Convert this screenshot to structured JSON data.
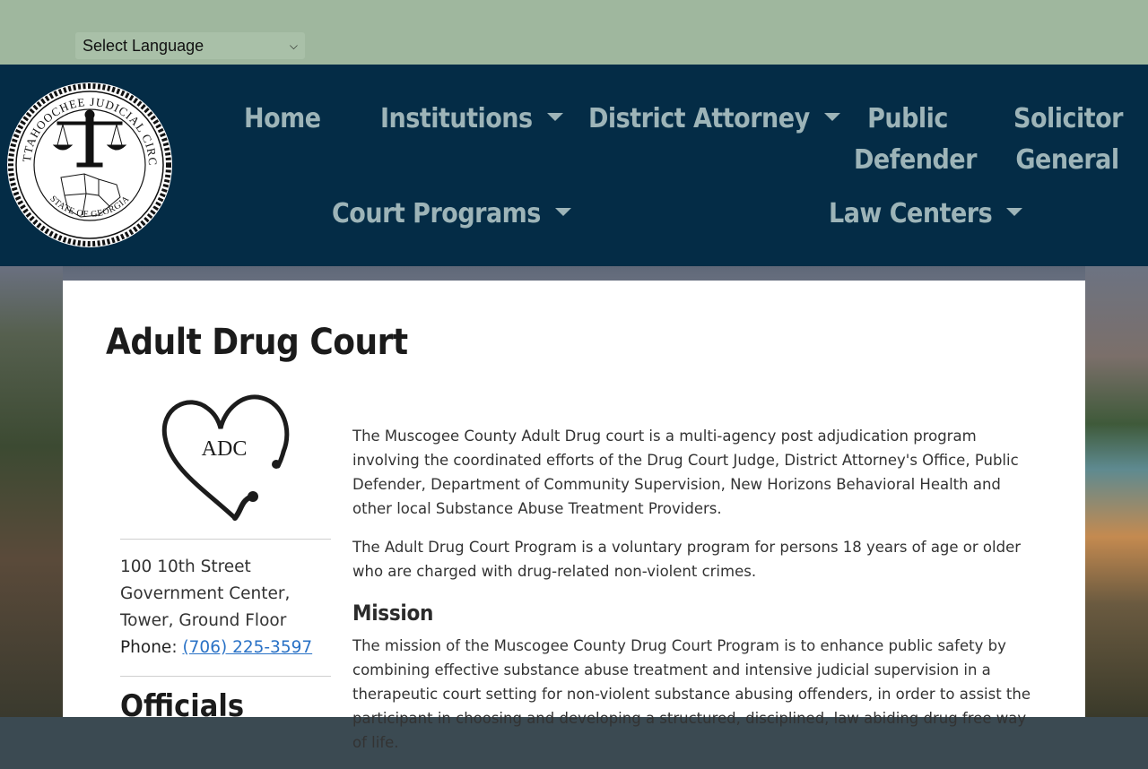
{
  "language": {
    "selected": "Select Language"
  },
  "seal": {
    "top_text": "CHATTAHOOCHEE JUDICIAL CIRCUIT",
    "bottom_text": "STATE OF GEORGIA"
  },
  "nav": {
    "home": "Home",
    "institutions": "Institutions",
    "district_attorney": "District Attorney",
    "public_defender_1": "Public",
    "public_defender_2": "Defender",
    "solicitor_general_1": "Solicitor",
    "solicitor_general_2": "General",
    "court_programs": "Court Programs",
    "law_centers": "Law Centers"
  },
  "page": {
    "title": "Adult Drug Court",
    "logo_text": "ADC"
  },
  "address": {
    "line1": "100 10th Street",
    "line2": "Government Center,",
    "line3": "Tower, Ground Floor",
    "phone_label": "Phone",
    "phone_number": "(706) 225-3597"
  },
  "officials_heading": "Officials",
  "content": {
    "p1": "The Muscogee County Adult Drug court is a multi-agency post adjudication program involving the coordinated efforts of the Drug Court Judge, District Attorney's Office, Public Defender, Department of Community Supervision, New Horizons Behavioral Health and other local Substance Abuse Treatment Providers.",
    "p2": "The Adult Drug Court Program is a voluntary program for persons 18 years of age or older who are charged with drug-related non-violent crimes.",
    "mission_heading": "Mission",
    "p3": "The mission of the Muscogee County Drug Court Program is to enhance public safety by combining effective substance abuse treatment and intensive judicial supervision in a therapeutic court setting for non-violent substance abusing offenders, in order to assist the participant in choosing and developing a structured, disciplined, law abiding drug free way of life."
  }
}
